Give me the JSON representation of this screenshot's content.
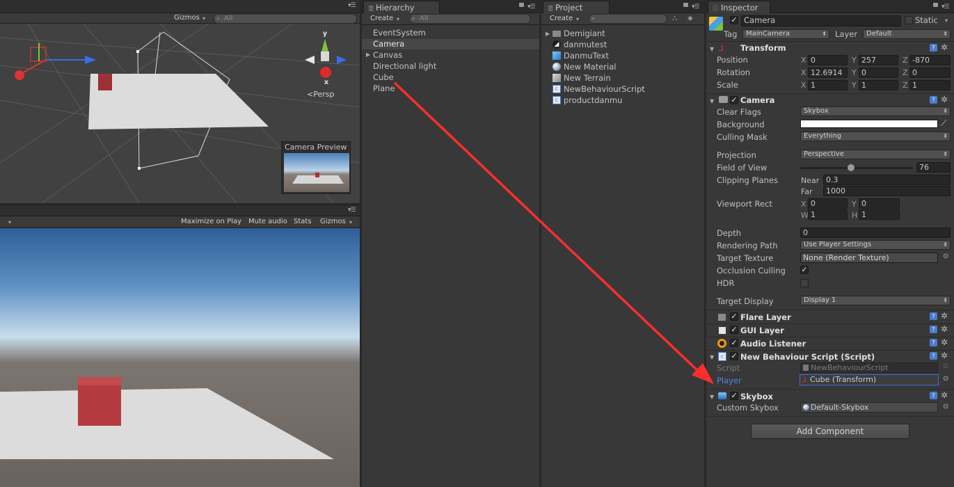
{
  "scene": {
    "gizmos_label": "Gizmos",
    "search_placeholder": "All",
    "persp_label": "<Persp",
    "axis_y": "y",
    "axis_x": "x",
    "preview_title": "Camera Preview"
  },
  "game": {
    "toolbar": [
      "Maximize on Play",
      "Mute audio",
      "Stats",
      "Gizmos"
    ]
  },
  "hierarchy": {
    "tab": "Hierarchy",
    "create": "Create",
    "search_placeholder": "All",
    "items": [
      "EventSystem",
      "Camera",
      "Canvas",
      "Directional light",
      "Cube",
      "Plane"
    ]
  },
  "project": {
    "tab": "Project",
    "create": "Create",
    "items": [
      "Demigiant",
      "danmutest",
      "DanmuText",
      "New Material",
      "New Terrain",
      "NewBehaviourScript",
      "productdanmu"
    ]
  },
  "inspector": {
    "tab": "Inspector",
    "object_name": "Camera",
    "static_label": "Static",
    "tag_label": "Tag",
    "tag_value": "MainCamera",
    "layer_label": "Layer",
    "layer_value": "Default",
    "transform": {
      "title": "Transform",
      "position_label": "Position",
      "rotation_label": "Rotation",
      "scale_label": "Scale",
      "position": {
        "x": "0",
        "y": "257",
        "z": "-870"
      },
      "rotation": {
        "x": "12.6914",
        "y": "0",
        "z": "0"
      },
      "scale": {
        "x": "1",
        "y": "1",
        "z": "1"
      }
    },
    "camera": {
      "title": "Camera",
      "clear_flags_label": "Clear Flags",
      "clear_flags": "Skybox",
      "background_label": "Background",
      "background_color": "#ffffff",
      "culling_mask_label": "Culling Mask",
      "culling_mask": "Everything",
      "projection_label": "Projection",
      "projection": "Perspective",
      "fov_label": "Field of View",
      "fov": "76",
      "fov_fraction": 0.45,
      "clipping_label": "Clipping Planes",
      "near_label": "Near",
      "near": "0.3",
      "far_label": "Far",
      "far": "1000",
      "viewport_label": "Viewport Rect",
      "vp_x": "0",
      "vp_y": "0",
      "vp_w": "1",
      "vp_h": "1",
      "depth_label": "Depth",
      "depth": "0",
      "rendering_path_label": "Rendering Path",
      "rendering_path": "Use Player Settings",
      "target_texture_label": "Target Texture",
      "target_texture": "None (Render Texture)",
      "occlusion_label": "Occlusion Culling",
      "hdr_label": "HDR",
      "target_display_label": "Target Display",
      "target_display": "Display 1"
    },
    "flare_title": "Flare Layer",
    "gui_title": "GUI Layer",
    "audio_title": "Audio Listener",
    "script": {
      "title": "New Behaviour Script (Script)",
      "script_label": "Script",
      "script_value": "NewBehaviourScript",
      "player_label": "Player",
      "player_value": "Cube (Transform)"
    },
    "skybox": {
      "title": "Skybox",
      "custom_label": "Custom Skybox",
      "custom_value": "Default-Skybox"
    },
    "add_component": "Add Component"
  },
  "colors": {
    "accent": "#3e6fd6",
    "arrow": "#ff2e2e",
    "cube": "#b6373a"
  }
}
